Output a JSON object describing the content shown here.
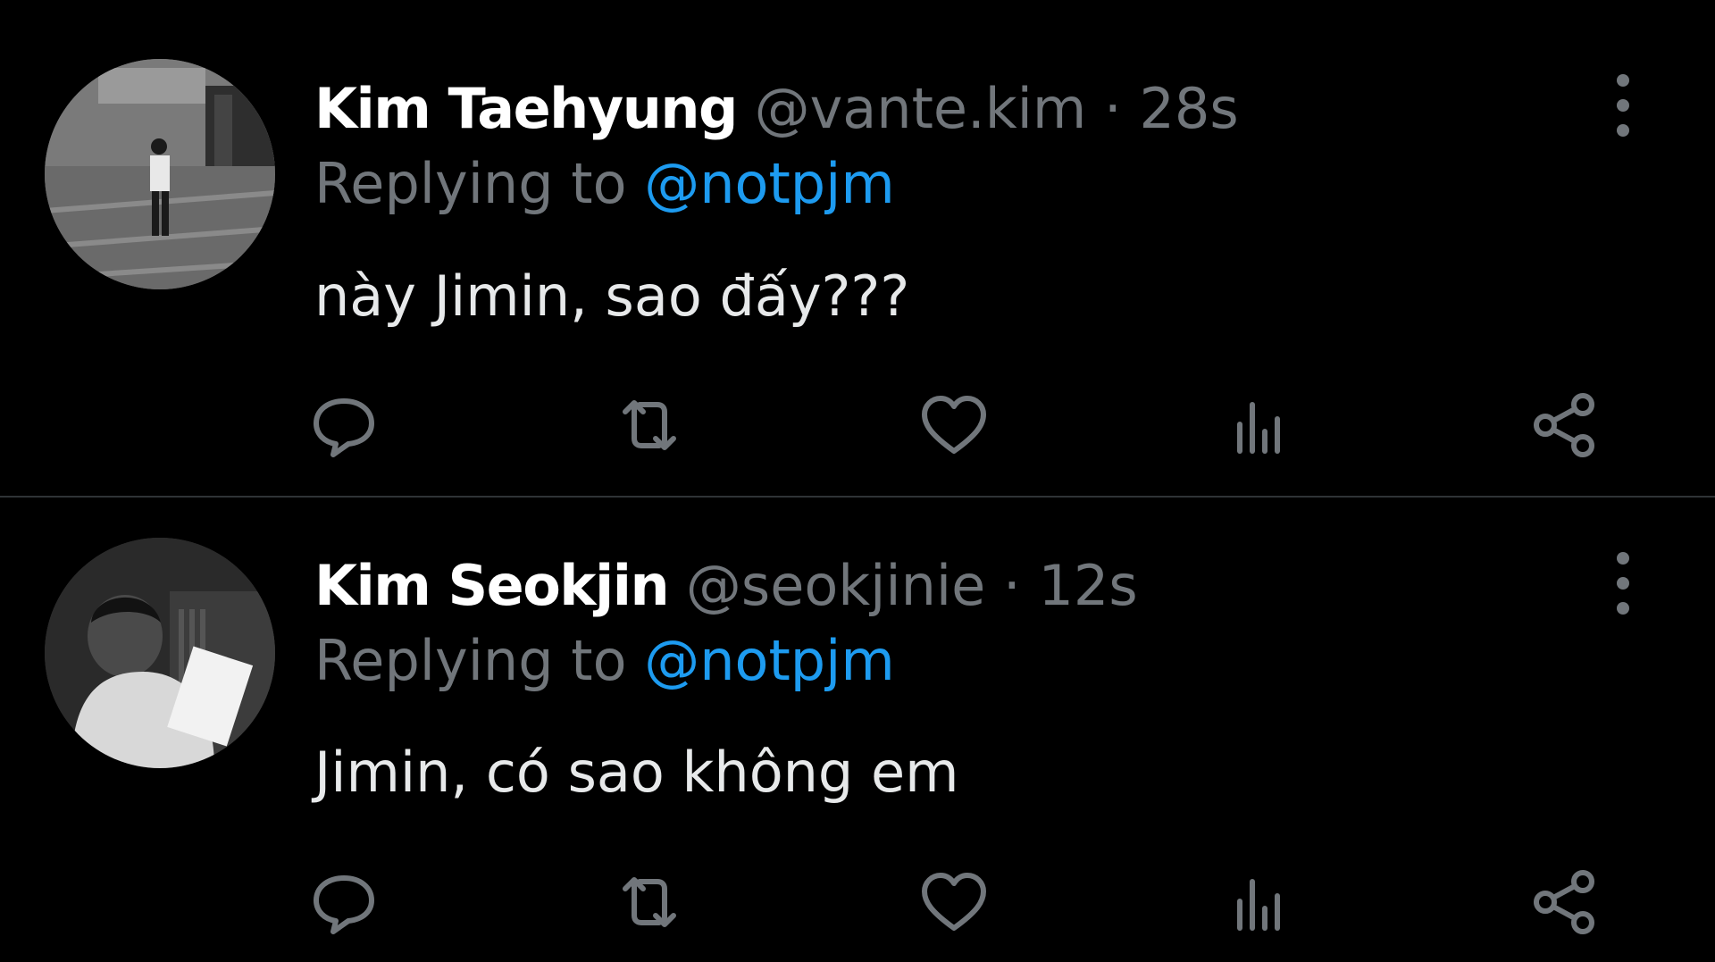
{
  "tweets": [
    {
      "author_name": "Kim Taehyung",
      "handle": "@vante.kim",
      "separator": "·",
      "time": "28s",
      "replying_to_label": "Replying to",
      "replying_to_handle": "@notpjm",
      "text": "này Jimin, sao đấy???"
    },
    {
      "author_name": "Kim Seokjin",
      "handle": "@seokjinie",
      "separator": "·",
      "time": "12s",
      "replying_to_label": "Replying to",
      "replying_to_handle": "@notpjm",
      "text": "Jimin, có sao không em"
    }
  ],
  "icons": {
    "more": "more-vertical-icon",
    "reply": "reply-icon",
    "retweet": "retweet-icon",
    "like": "heart-icon",
    "views": "views-icon",
    "share": "share-icon"
  },
  "colors": {
    "background": "#000000",
    "name": "#ffffff",
    "muted": "#71767b",
    "mention": "#1d9bf0",
    "text": "#e7e9ea",
    "divider": "#2f3336"
  }
}
